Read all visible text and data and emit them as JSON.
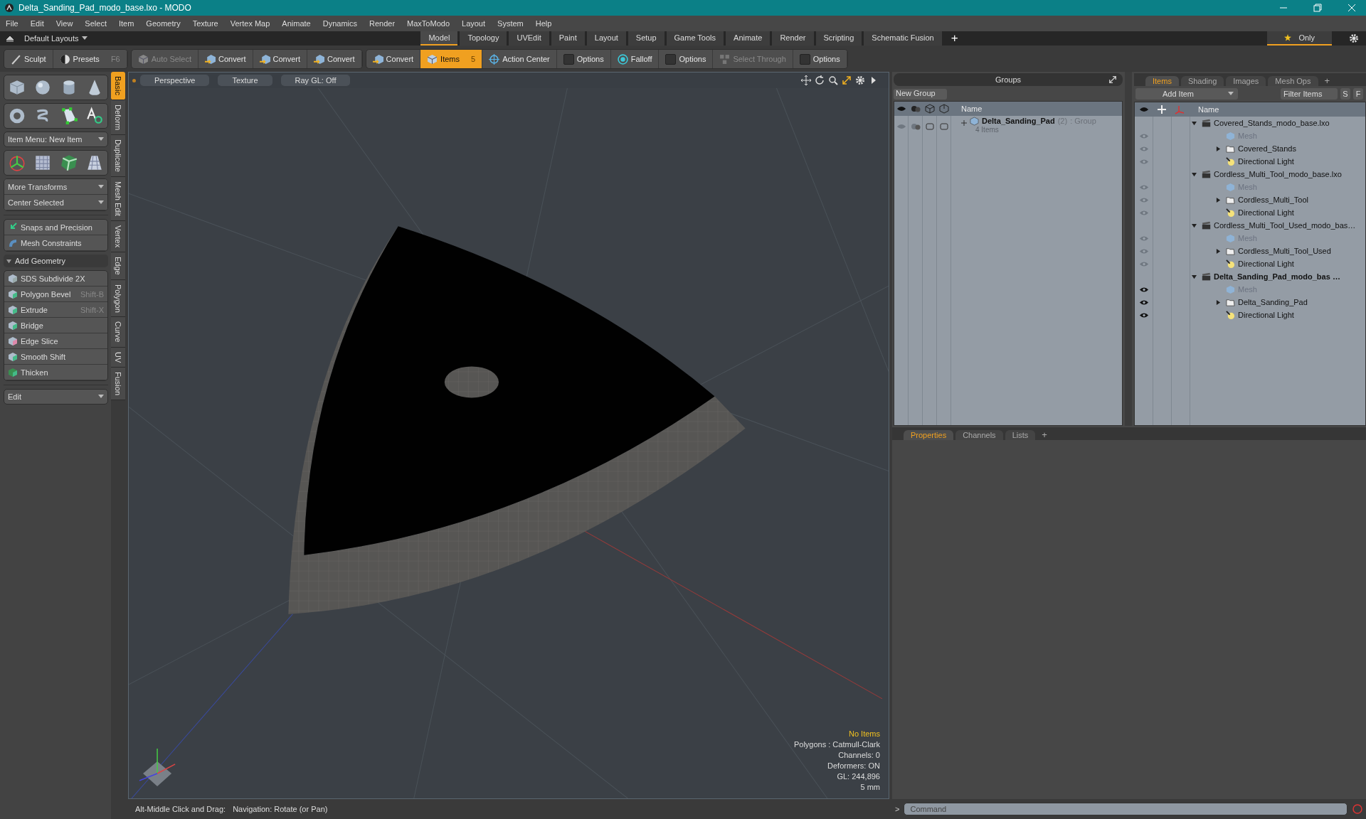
{
  "window": {
    "title": "Delta_Sanding_Pad_modo_base.lxo - MODO"
  },
  "menu": [
    "File",
    "Edit",
    "View",
    "Select",
    "Item",
    "Geometry",
    "Texture",
    "Vertex Map",
    "Animate",
    "Dynamics",
    "Render",
    "MaxToModo",
    "Layout",
    "System",
    "Help"
  ],
  "layout_bar": {
    "layout_menu": "Default Layouts",
    "tabs": [
      {
        "label": "Model",
        "selected": true
      },
      {
        "label": "Topology",
        "selected": false
      },
      {
        "label": "UVEdit",
        "selected": false
      },
      {
        "label": "Paint",
        "selected": false
      },
      {
        "label": "Layout",
        "selected": false
      },
      {
        "label": "Setup",
        "selected": false
      },
      {
        "label": "Game Tools",
        "selected": false
      },
      {
        "label": "Animate",
        "selected": false
      },
      {
        "label": "Render",
        "selected": false
      },
      {
        "label": "Scripting",
        "selected": false
      },
      {
        "label": "Schematic Fusion",
        "selected": false
      }
    ],
    "add_tab": "+",
    "only_button": "Only"
  },
  "toolbar": {
    "groups": [
      [
        {
          "kind": "sculpt",
          "label": "Sculpt",
          "disabled": false,
          "selected": false
        },
        {
          "kind": "presets",
          "label": "Presets",
          "shortcut": "F6",
          "disabled": false,
          "selected": false
        }
      ],
      [
        {
          "kind": "auto_select",
          "label": "Auto Select",
          "disabled": true,
          "selected": false
        },
        {
          "kind": "convert",
          "label": "Convert",
          "disabled": false,
          "selected": false
        },
        {
          "kind": "convert",
          "label": "Convert",
          "disabled": false,
          "selected": false
        },
        {
          "kind": "convert",
          "label": "Convert",
          "disabled": false,
          "selected": false
        }
      ],
      [
        {
          "kind": "convert",
          "label": "Convert",
          "disabled": false,
          "selected": false
        },
        {
          "kind": "items",
          "label": "Items",
          "shortcut": "5",
          "disabled": false,
          "selected": true
        },
        {
          "kind": "action_center",
          "label": "Action Center",
          "disabled": false,
          "selected": false
        },
        {
          "kind": "toggle",
          "label": "Options",
          "disabled": false,
          "selected": false
        },
        {
          "kind": "falloff",
          "label": "Falloff",
          "disabled": false,
          "selected": false
        },
        {
          "kind": "toggle",
          "label": "Options",
          "disabled": false,
          "selected": false
        },
        {
          "kind": "select_through",
          "label": "Select Through",
          "disabled": true,
          "selected": false
        },
        {
          "kind": "toggle",
          "label": "Options",
          "disabled": false,
          "selected": false
        }
      ]
    ]
  },
  "left_panel": {
    "tool_tabs": [
      {
        "label": "Basic",
        "selected": true
      },
      {
        "label": "Deform",
        "selected": false
      },
      {
        "label": "Duplicate",
        "selected": false
      },
      {
        "label": "Mesh Edit",
        "selected": false
      },
      {
        "label": "Vertex",
        "selected": false
      },
      {
        "label": "Edge",
        "selected": false
      },
      {
        "label": "Polygon",
        "selected": false
      },
      {
        "label": "Curve",
        "selected": false
      },
      {
        "label": "UV",
        "selected": false
      },
      {
        "label": "Fusion",
        "selected": false
      }
    ],
    "item_menu": "Item Menu: New Item",
    "transform_menus": [
      "More Transforms",
      "Center Selected"
    ],
    "snapping": [
      "Snaps and Precision",
      "Mesh Constraints"
    ],
    "section": {
      "label": "Add Geometry",
      "expanded": true,
      "tools": [
        {
          "kind": "subdivide",
          "label": "SDS Subdivide 2X"
        },
        {
          "kind": "bevel",
          "label": "Polygon Bevel",
          "shortcut": "Shift-B"
        },
        {
          "kind": "extrude",
          "label": "Extrude",
          "shortcut": "Shift-X"
        },
        {
          "kind": "bridge",
          "label": "Bridge"
        },
        {
          "kind": "edge_slice",
          "label": "Edge Slice"
        },
        {
          "kind": "smooth_shift",
          "label": "Smooth Shift"
        },
        {
          "kind": "thicken",
          "label": "Thicken"
        }
      ]
    },
    "edit_menu": "Edit"
  },
  "viewport": {
    "view_buttons": [
      "Perspective",
      "Texture",
      "Ray GL: Off"
    ],
    "info": [
      {
        "text": "No Items",
        "highlight": true
      },
      {
        "text": "Polygons : Catmull-Clark",
        "highlight": false
      },
      {
        "text": "Channels: 0",
        "highlight": false
      },
      {
        "text": "Deformers: ON",
        "highlight": false
      },
      {
        "text": "GL: 244,896",
        "highlight": false
      },
      {
        "text": "5 mm",
        "highlight": false
      }
    ]
  },
  "status_bar": {
    "hint": "Alt-Middle Click and Drag:",
    "action": "Navigation: Rotate (or Pan)"
  },
  "groups_panel": {
    "title": "Groups",
    "new_group": "New Group",
    "name_header": "Name",
    "groups": [
      {
        "name": "Delta_Sanding_Pad",
        "count": "(2)",
        "type": ": Group",
        "items": "4 Items"
      }
    ]
  },
  "items_panel": {
    "tabs": [
      {
        "label": "Items",
        "selected": true
      },
      {
        "label": "Shading",
        "selected": false
      },
      {
        "label": "Images",
        "selected": false
      },
      {
        "label": "Mesh Ops",
        "selected": false
      }
    ],
    "add_tab": "+",
    "add_item": "Add Item",
    "filter_placeholder": "Filter Items",
    "toggles": [
      "S",
      "F"
    ],
    "name_header": "Name",
    "tree": [
      {
        "kind": "scene",
        "label": "Covered_Stands_modo_base.lxo",
        "active": false,
        "expanded": true,
        "children": [
          {
            "kind": "mesh",
            "label": "Mesh"
          },
          {
            "kind": "group",
            "label": "Covered_Stands",
            "expanded": false
          },
          {
            "kind": "light",
            "label": "Directional Light"
          }
        ]
      },
      {
        "kind": "scene",
        "label": "Cordless_Multi_Tool_modo_base.lxo",
        "active": false,
        "expanded": true,
        "children": [
          {
            "kind": "mesh",
            "label": "Mesh"
          },
          {
            "kind": "group",
            "label": "Cordless_Multi_Tool",
            "expanded": false
          },
          {
            "kind": "light",
            "label": "Directional Light"
          }
        ]
      },
      {
        "kind": "scene",
        "label": "Cordless_Multi_Tool_Used_modo_bas…",
        "active": false,
        "expanded": true,
        "children": [
          {
            "kind": "mesh",
            "label": "Mesh"
          },
          {
            "kind": "group",
            "label": "Cordless_Multi_Tool_Used",
            "expanded": false
          },
          {
            "kind": "light",
            "label": "Directional Light"
          }
        ]
      },
      {
        "kind": "scene",
        "label": "Delta_Sanding_Pad_modo_bas …",
        "active": true,
        "expanded": true,
        "children": [
          {
            "kind": "mesh",
            "label": "Mesh"
          },
          {
            "kind": "group",
            "label": "Delta_Sanding_Pad",
            "expanded": false
          },
          {
            "kind": "light",
            "label": "Directional Light"
          }
        ]
      }
    ]
  },
  "properties_panel": {
    "tabs": [
      {
        "label": "Properties",
        "selected": true
      },
      {
        "label": "Channels",
        "selected": false
      },
      {
        "label": "Lists",
        "selected": false
      }
    ],
    "add_tab": "+"
  },
  "command": {
    "prompt": ">",
    "placeholder": "Command"
  }
}
